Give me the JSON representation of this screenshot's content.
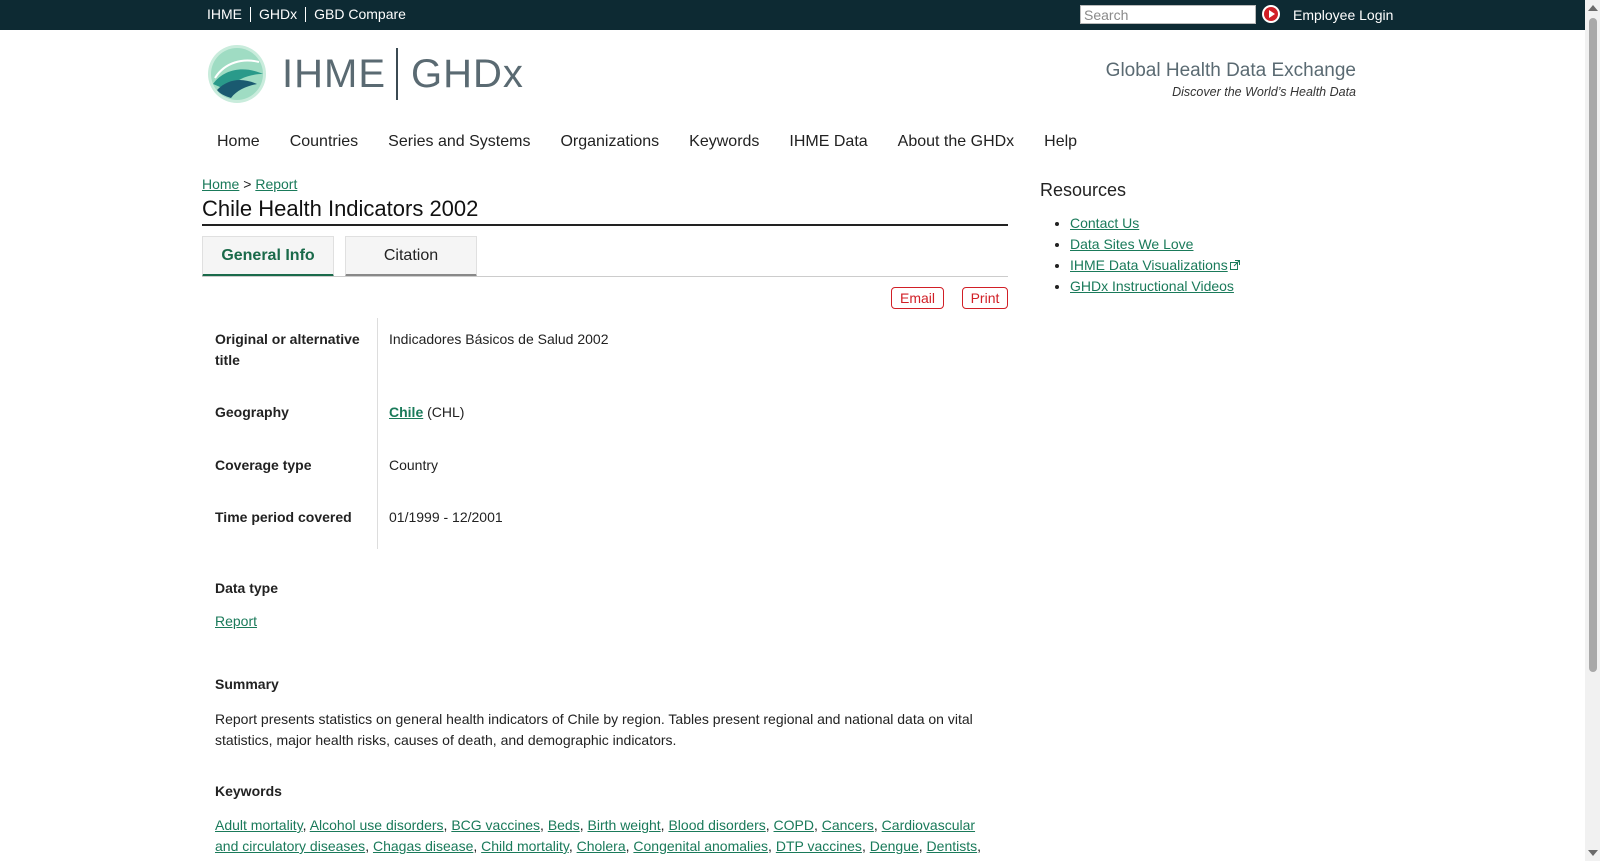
{
  "topbar": {
    "links": [
      "IHME",
      "GHDx",
      "GBD Compare"
    ],
    "search_placeholder": "Search",
    "login_label": "Employee Login"
  },
  "header": {
    "logo_ihme": "IHME",
    "logo_ghdx": "GHDx",
    "tagline_title": "Global Health Data Exchange",
    "tagline_sub": "Discover the World’s Health Data"
  },
  "nav": {
    "items": [
      "Home",
      "Countries",
      "Series and Systems",
      "Organizations",
      "Keywords",
      "IHME Data",
      "About the GHDx",
      "Help"
    ]
  },
  "breadcrumb": {
    "home": "Home",
    "sep": ">",
    "current": "Report"
  },
  "page": {
    "title": "Chile Health Indicators 2002"
  },
  "tabs": {
    "general": "General Info",
    "citation": "Citation"
  },
  "actions": {
    "email": "Email",
    "print": "Print"
  },
  "fields": {
    "alt_title_label_1": "Original or alternative",
    "alt_title_label_2": "title",
    "alt_title_value": "Indicadores Básicos de Salud 2002",
    "geography_label": "Geography",
    "geography_link": "Chile",
    "geography_code": "(CHL)",
    "coverage_label": "Coverage type",
    "coverage_value": "Country",
    "time_label": "Time period covered",
    "time_value": "01/1999 - 12/2001"
  },
  "data_type": {
    "label": "Data type",
    "value": "Report"
  },
  "summary": {
    "label": "Summary",
    "text": "Report presents statistics on general health indicators of Chile by region. Tables present regional and national data on vital statistics, major health risks, causes of death, and demographic indicators."
  },
  "keywords": {
    "label": "Keywords",
    "items": [
      "Adult mortality",
      "Alcohol use disorders",
      "BCG vaccines",
      "Beds",
      "Birth weight",
      "Blood disorders",
      "COPD",
      "Cancers",
      "Cardiovascular and circulatory diseases",
      "Chagas disease",
      "Child mortality",
      "Cholera",
      "Congenital anomalies",
      "DTP vaccines",
      "Dengue",
      "Dentists"
    ]
  },
  "resources": {
    "title": "Resources",
    "links": [
      "Contact Us",
      "Data Sites We Love",
      "IHME Data Visualizations",
      "GHDx Instructional Videos"
    ]
  },
  "colors": {
    "topbar": "#0d2a33",
    "link": "#1a7a5a",
    "accent_red": "#d11f26",
    "tab_active": "#1a6a4a"
  }
}
